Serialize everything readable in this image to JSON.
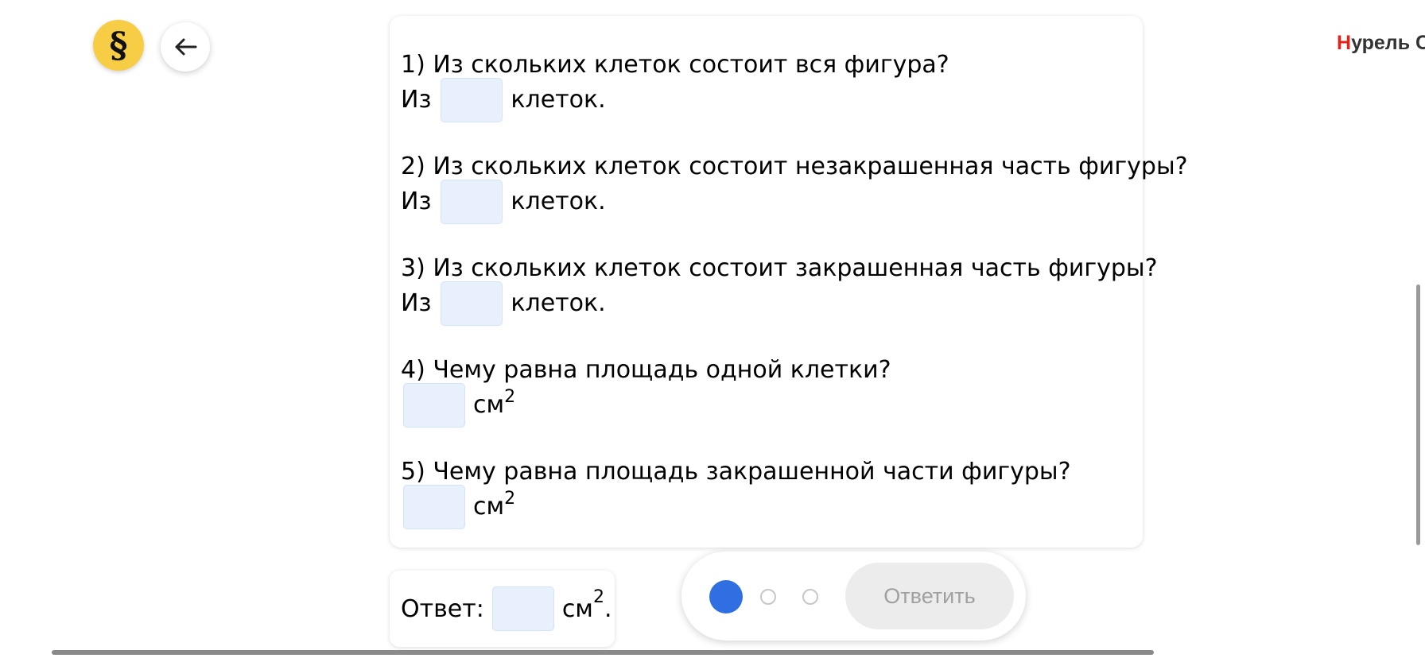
{
  "header": {
    "logo_symbol": "§",
    "user_name_first_letter": "Н",
    "user_name_rest": "урель С"
  },
  "questions": [
    {
      "text": "1) Из скольких клеток состоит вся фигура?",
      "answer_prefix": "Из",
      "answer_suffix": "клеток."
    },
    {
      "text": "2) Из скольких клеток состоит незакрашенная часть фигуры?",
      "answer_prefix": "Из",
      "answer_suffix": "клеток."
    },
    {
      "text": "3) Из скольких клеток состоит закрашенная часть фигуры?",
      "answer_prefix": "Из",
      "answer_suffix": "клеток."
    },
    {
      "text": "4) Чему равна площадь одной клетки?",
      "answer_unit": "см",
      "answer_unit_exp": "2"
    },
    {
      "text": "5) Чему равна площадь закрашенной части фигуры?",
      "answer_unit": "см",
      "answer_unit_exp": "2"
    }
  ],
  "answer": {
    "label": "Ответ:",
    "unit": "см",
    "unit_exp": "2",
    "unit_end": "."
  },
  "controls": {
    "submit_label": "Ответить",
    "progress_total": 3,
    "progress_current": 1
  },
  "colors": {
    "logo": "#f7cd46",
    "input_bg": "#e7f0fc",
    "active_dot": "#2f6fe1",
    "name_accent": "#e2231a"
  }
}
